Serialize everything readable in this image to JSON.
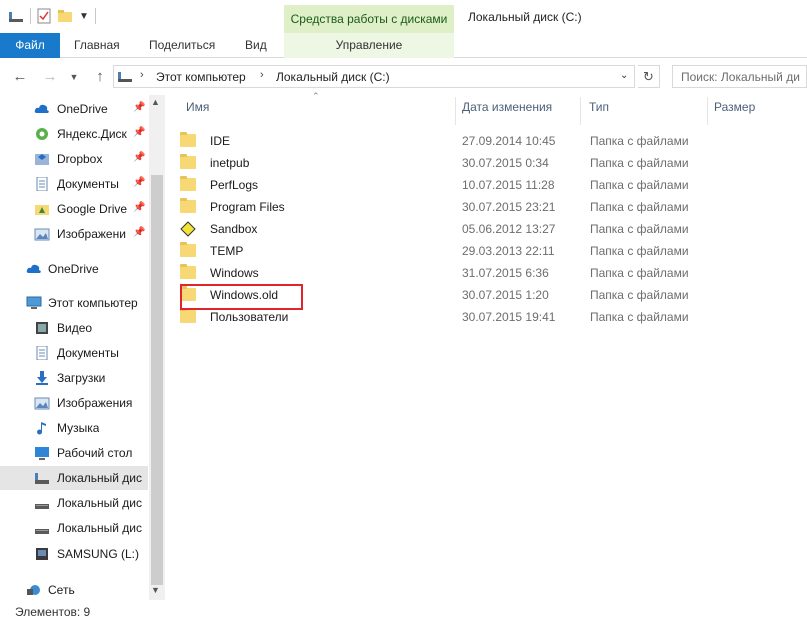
{
  "titlebar": {
    "context_group": "Средства работы с дисками",
    "window_title": "Локальный диск (C:)"
  },
  "ribbon": {
    "tabs": [
      {
        "label": "Файл"
      },
      {
        "label": "Главная"
      },
      {
        "label": "Поделиться"
      },
      {
        "label": "Вид"
      },
      {
        "label": "Управление"
      }
    ]
  },
  "address": {
    "segments": [
      "Этот компьютер",
      "Локальный диск (C:)"
    ]
  },
  "search": {
    "placeholder": "Поиск: Локальный ди"
  },
  "nav": {
    "items": [
      {
        "label": "OneDrive",
        "icon": "cloud-icon",
        "pinned": true
      },
      {
        "label": "Яндекс.Диск",
        "icon": "yandex-disk-icon",
        "pinned": true
      },
      {
        "label": "Dropbox",
        "icon": "dropbox-icon",
        "pinned": true
      },
      {
        "label": "Документы",
        "icon": "documents-icon",
        "pinned": true
      },
      {
        "label": "Google Drive",
        "icon": "google-drive-icon",
        "pinned": true
      },
      {
        "label": "Изображени",
        "icon": "pictures-icon",
        "pinned": true
      },
      {
        "label": "OneDrive",
        "icon": "cloud-icon",
        "pinned": false
      },
      {
        "label": "Этот компьютер",
        "icon": "computer-icon",
        "pinned": false
      },
      {
        "label": "Видео",
        "icon": "video-icon",
        "pinned": false
      },
      {
        "label": "Документы",
        "icon": "documents-icon",
        "pinned": false
      },
      {
        "label": "Загрузки",
        "icon": "downloads-icon",
        "pinned": false
      },
      {
        "label": "Изображения",
        "icon": "pictures-icon",
        "pinned": false
      },
      {
        "label": "Музыка",
        "icon": "music-icon",
        "pinned": false
      },
      {
        "label": "Рабочий стол",
        "icon": "desktop-icon",
        "pinned": false
      },
      {
        "label": "Локальный дис",
        "icon": "drive-icon",
        "pinned": false,
        "selected": true
      },
      {
        "label": "Локальный дис",
        "icon": "drive-icon",
        "pinned": false
      },
      {
        "label": "Локальный дис",
        "icon": "drive-icon",
        "pinned": false
      },
      {
        "label": "SAMSUNG (L:)",
        "icon": "usb-drive-icon",
        "pinned": false
      },
      {
        "label": "Сеть",
        "icon": "network-icon",
        "pinned": false
      }
    ]
  },
  "columns": {
    "name": "Имя",
    "date": "Дата изменения",
    "type": "Тип",
    "size": "Размер"
  },
  "files": [
    {
      "name": "IDE",
      "date": "27.09.2014 10:45",
      "type": "Папка с файлами"
    },
    {
      "name": "inetpub",
      "date": "30.07.2015 0:34",
      "type": "Папка с файлами"
    },
    {
      "name": "PerfLogs",
      "date": "10.07.2015 11:28",
      "type": "Папка с файлами"
    },
    {
      "name": "Program Files",
      "date": "30.07.2015 23:21",
      "type": "Папка с файлами"
    },
    {
      "name": "Sandbox",
      "date": "05.06.2012 13:27",
      "type": "Папка с файлами"
    },
    {
      "name": "TEMP",
      "date": "29.03.2013 22:11",
      "type": "Папка с файлами"
    },
    {
      "name": "Windows",
      "date": "31.07.2015 6:36",
      "type": "Папка с файлами"
    },
    {
      "name": "Windows.old",
      "date": "30.07.2015 1:20",
      "type": "Папка с файлами"
    },
    {
      "name": "Пользователи",
      "date": "30.07.2015 19:41",
      "type": "Папка с файлами"
    }
  ],
  "status": {
    "text": "Элементов: 9"
  },
  "colors": {
    "file_tab": "#1979ca",
    "context_group": "#dff0c9",
    "highlight": "#e0262b",
    "folder": "#f8d775"
  }
}
